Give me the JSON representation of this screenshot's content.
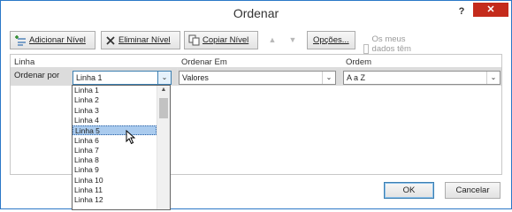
{
  "title": "Ordenar",
  "titlebar": {
    "help_glyph": "?",
    "close_glyph": "✕"
  },
  "toolbar": {
    "add_level": "Adicionar Nível",
    "delete_level": "Eliminar Nível",
    "copy_level": "Copiar Nível",
    "move_up_glyph": "▲",
    "move_down_glyph": "▼",
    "options": "Opções...",
    "headers_checkbox": "Os meus dados têm cabeçalhos"
  },
  "columns": {
    "column": "Linha",
    "sort_on": "Ordenar Em",
    "order": "Ordem"
  },
  "row": {
    "label": "Ordenar por",
    "column_value": "Linha 1",
    "sort_on_value": "Valores",
    "order_value": "A a Z"
  },
  "dropdown_glyph": "⌄",
  "dropdown": {
    "items": [
      "Linha 1",
      "Linha 2",
      "Linha 3",
      "Linha 4",
      "Linha 5",
      "Linha 6",
      "Linha 7",
      "Linha 8",
      "Linha 9",
      "Linha 10",
      "Linha 11",
      "Linha 12"
    ],
    "highlighted": "Linha 5",
    "scroll_up_glyph": "▲"
  },
  "footer": {
    "ok": "OK",
    "cancel": "Cancelar"
  },
  "colors": {
    "window_border": "#2b78c7",
    "close_red": "#c42b1c",
    "highlight": "#aacbee",
    "row_select": "#dcdcdc"
  }
}
